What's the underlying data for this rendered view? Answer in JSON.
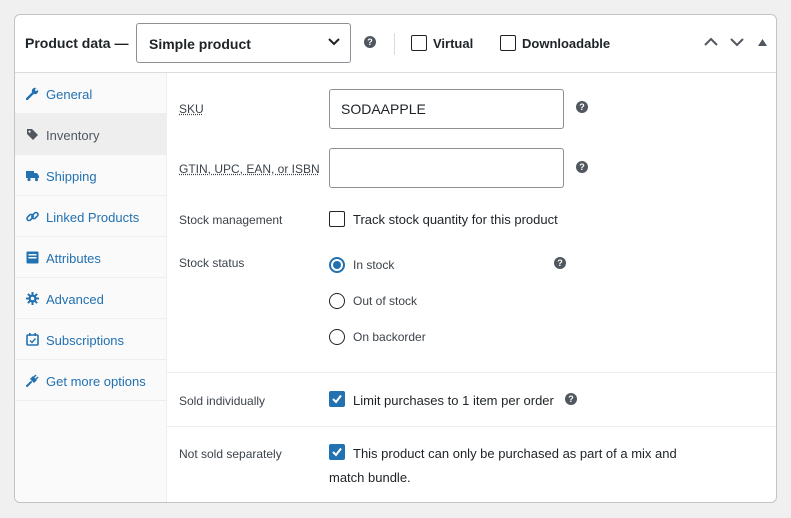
{
  "header": {
    "title": "Product data —",
    "product_type": "Simple product",
    "virtual_label": "Virtual",
    "downloadable_label": "Downloadable"
  },
  "tabs": [
    {
      "label": "General",
      "icon": "wrench-icon"
    },
    {
      "label": "Inventory",
      "icon": "tag-icon"
    },
    {
      "label": "Shipping",
      "icon": "truck-icon"
    },
    {
      "label": "Linked Products",
      "icon": "link-icon"
    },
    {
      "label": "Attributes",
      "icon": "list-icon"
    },
    {
      "label": "Advanced",
      "icon": "gear-icon"
    },
    {
      "label": "Subscriptions",
      "icon": "calendar-icon"
    },
    {
      "label": "Get more options",
      "icon": "plugin-icon"
    }
  ],
  "active_tab": "Inventory",
  "inventory": {
    "sku_label": "SKU",
    "sku_value": "SODAAPPLE",
    "gtin_label": "GTIN, UPC, EAN, or ISBN",
    "gtin_value": "",
    "stock_management_label": "Stock management",
    "stock_management_text": "Track stock quantity for this product",
    "stock_status_label": "Stock status",
    "stock_status_options": [
      "In stock",
      "Out of stock",
      "On backorder"
    ],
    "stock_status_selected": "In stock",
    "sold_individually_label": "Sold individually",
    "sold_individually_text": "Limit purchases to 1 item per order",
    "not_sold_separately_label": "Not sold separately",
    "not_sold_separately_text_1": "This product can only be purchased as part of a mix and",
    "not_sold_separately_text_2": "match bundle."
  },
  "colors": {
    "accent": "#2271b1",
    "text": "#1d2327",
    "border": "#8c8f94"
  }
}
